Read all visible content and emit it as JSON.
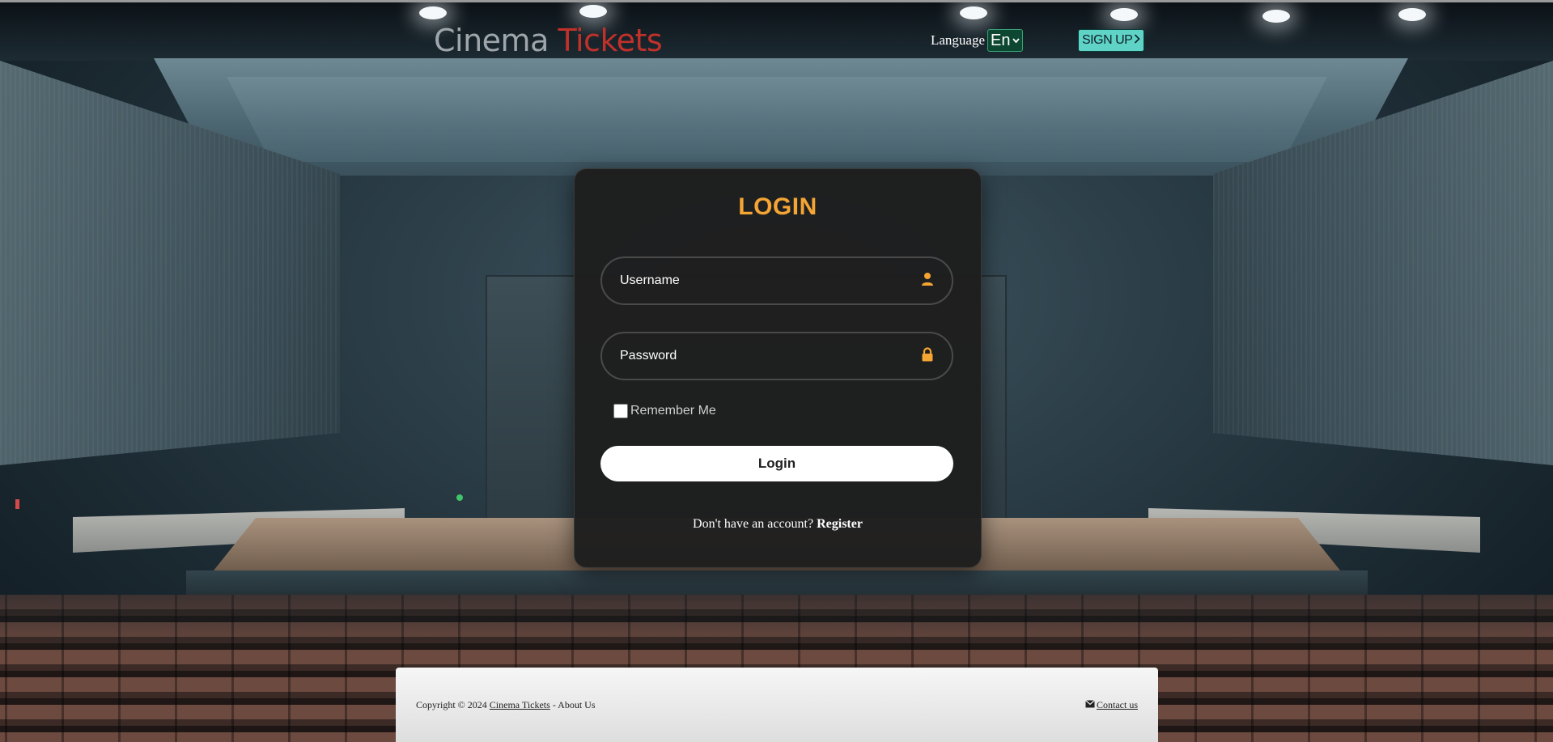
{
  "header": {
    "brand_part1": "Cinema",
    "brand_part2": "Tickets",
    "language_label": "Language",
    "language_selected": "En",
    "signup_label": "SIGN UP"
  },
  "login": {
    "title": "LOGIN",
    "username_placeholder": "Username",
    "password_placeholder": "Password",
    "remember_label": "Remember Me",
    "remember_checked": false,
    "submit_label": "Login",
    "no_account_text": "Don't have an account?",
    "register_label": "Register"
  },
  "footer": {
    "copyright_prefix": "Copyright © 2024",
    "brand_link": "Cinema Tickets",
    "about_sep": "-",
    "about_label": "About Us",
    "contact_label": "Contact us"
  },
  "colors": {
    "brand_accent": "#c0312b",
    "login_title": "#f4a534",
    "icon_accent": "#f4a534",
    "signup_bg": "#5ed3c6",
    "language_bg": "#0d4731"
  },
  "icons": {
    "username": "user-icon",
    "password": "lock-icon",
    "signup": "chevron-right-icon",
    "language": "chevron-down-icon",
    "contact": "envelope-icon"
  }
}
